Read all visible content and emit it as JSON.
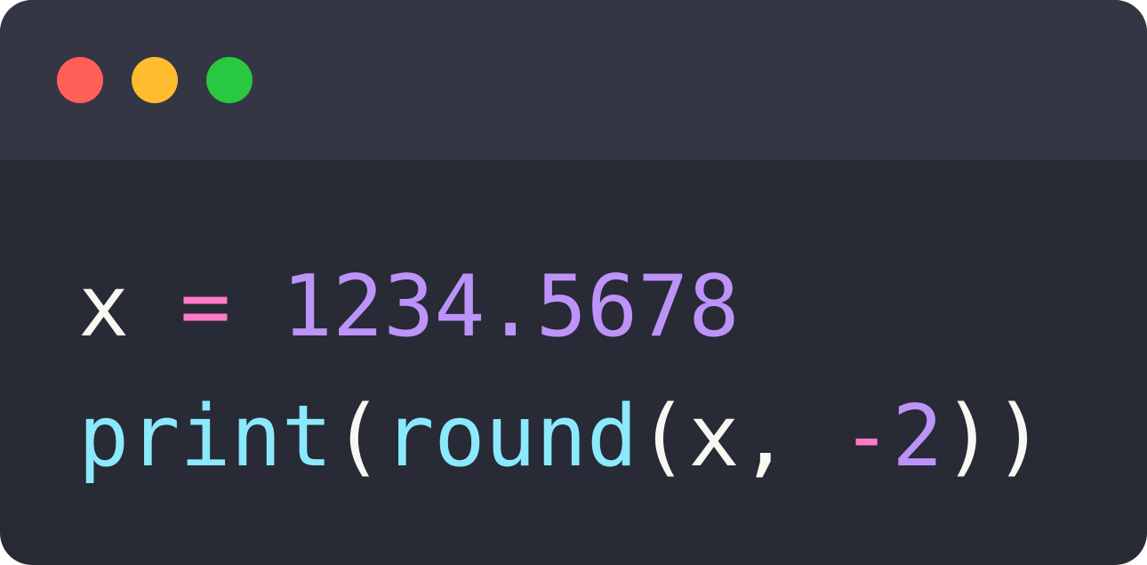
{
  "window": {
    "controls": [
      {
        "name": "close",
        "color": "#ff5f57"
      },
      {
        "name": "minimize",
        "color": "#febc2e"
      },
      {
        "name": "zoom",
        "color": "#28c840"
      }
    ]
  },
  "code": {
    "line1": {
      "var": "x",
      "space1": " ",
      "op": "=",
      "space2": " ",
      "number": "1234.5678"
    },
    "line2": {
      "fn_print": "print",
      "paren_open_1": "(",
      "fn_round": "round",
      "paren_open_2": "(",
      "arg_var": "x",
      "comma": ",",
      "space": " ",
      "minus": "-",
      "arg_num": "2",
      "paren_close": "))"
    }
  },
  "colors": {
    "plain": "#f8f8f2",
    "operator": "#ff79c6",
    "number": "#bd93f9",
    "function": "#8be9fd",
    "background": "#282a36",
    "titlebar": "#343643"
  }
}
